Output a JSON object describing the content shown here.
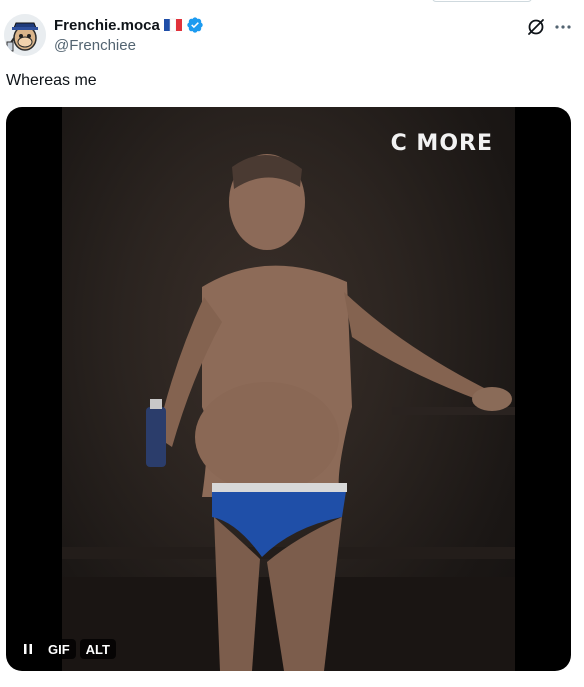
{
  "author": {
    "display_name": "Frenchie.moca",
    "handle": "@Frenchiee",
    "flag": "france-flag-icon",
    "verified": true,
    "verified_color": "#1d9bf0"
  },
  "tweet": {
    "text": "Whereas me"
  },
  "media": {
    "type": "GIF",
    "watermark": "C MORE",
    "controls": {
      "pause_icon": "pause-icon",
      "gif_label": "GIF",
      "alt_label": "ALT"
    }
  },
  "header_actions": {
    "grok_icon": "grok-icon",
    "more_icon": "more-icon"
  }
}
